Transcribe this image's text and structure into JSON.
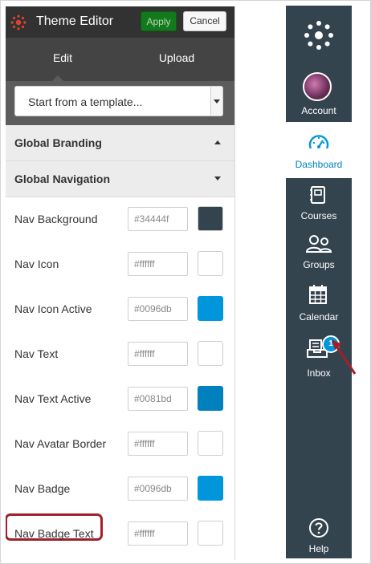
{
  "editor": {
    "title": "Theme Editor",
    "apply_label": "Apply",
    "cancel_label": "Cancel",
    "tabs": [
      {
        "label": "Edit",
        "active": true
      },
      {
        "label": "Upload",
        "active": false
      }
    ],
    "template_select": {
      "value": "Start from a template..."
    },
    "sections": [
      {
        "title": "Global Branding",
        "expanded": false
      },
      {
        "title": "Global Navigation",
        "expanded": true
      }
    ],
    "rows": [
      {
        "label": "Nav Background",
        "value": "#34444f",
        "swatch": "#34444f"
      },
      {
        "label": "Nav Icon",
        "value": "#ffffff",
        "swatch": "#ffffff"
      },
      {
        "label": "Nav Icon Active",
        "value": "#0096db",
        "swatch": "#0096db"
      },
      {
        "label": "Nav Text",
        "value": "#ffffff",
        "swatch": "#ffffff"
      },
      {
        "label": "Nav Text Active",
        "value": "#0081bd",
        "swatch": "#0081bd"
      },
      {
        "label": "Nav Avatar Border",
        "value": "#ffffff",
        "swatch": "#ffffff"
      },
      {
        "label": "Nav Badge",
        "value": "#0096db",
        "swatch": "#0096db"
      },
      {
        "label": "Nav Badge Text",
        "value": "#ffffff",
        "swatch": "#ffffff"
      }
    ]
  },
  "global_nav": {
    "background": "#34444f",
    "account_label": "Account",
    "dashboard_label": "Dashboard",
    "courses_label": "Courses",
    "groups_label": "Groups",
    "calendar_label": "Calendar",
    "inbox_label": "Inbox",
    "inbox_badge": "1",
    "help_label": "Help",
    "active_color": "#0081bd"
  },
  "annotation": {
    "highlight_color": "#a0202a"
  }
}
